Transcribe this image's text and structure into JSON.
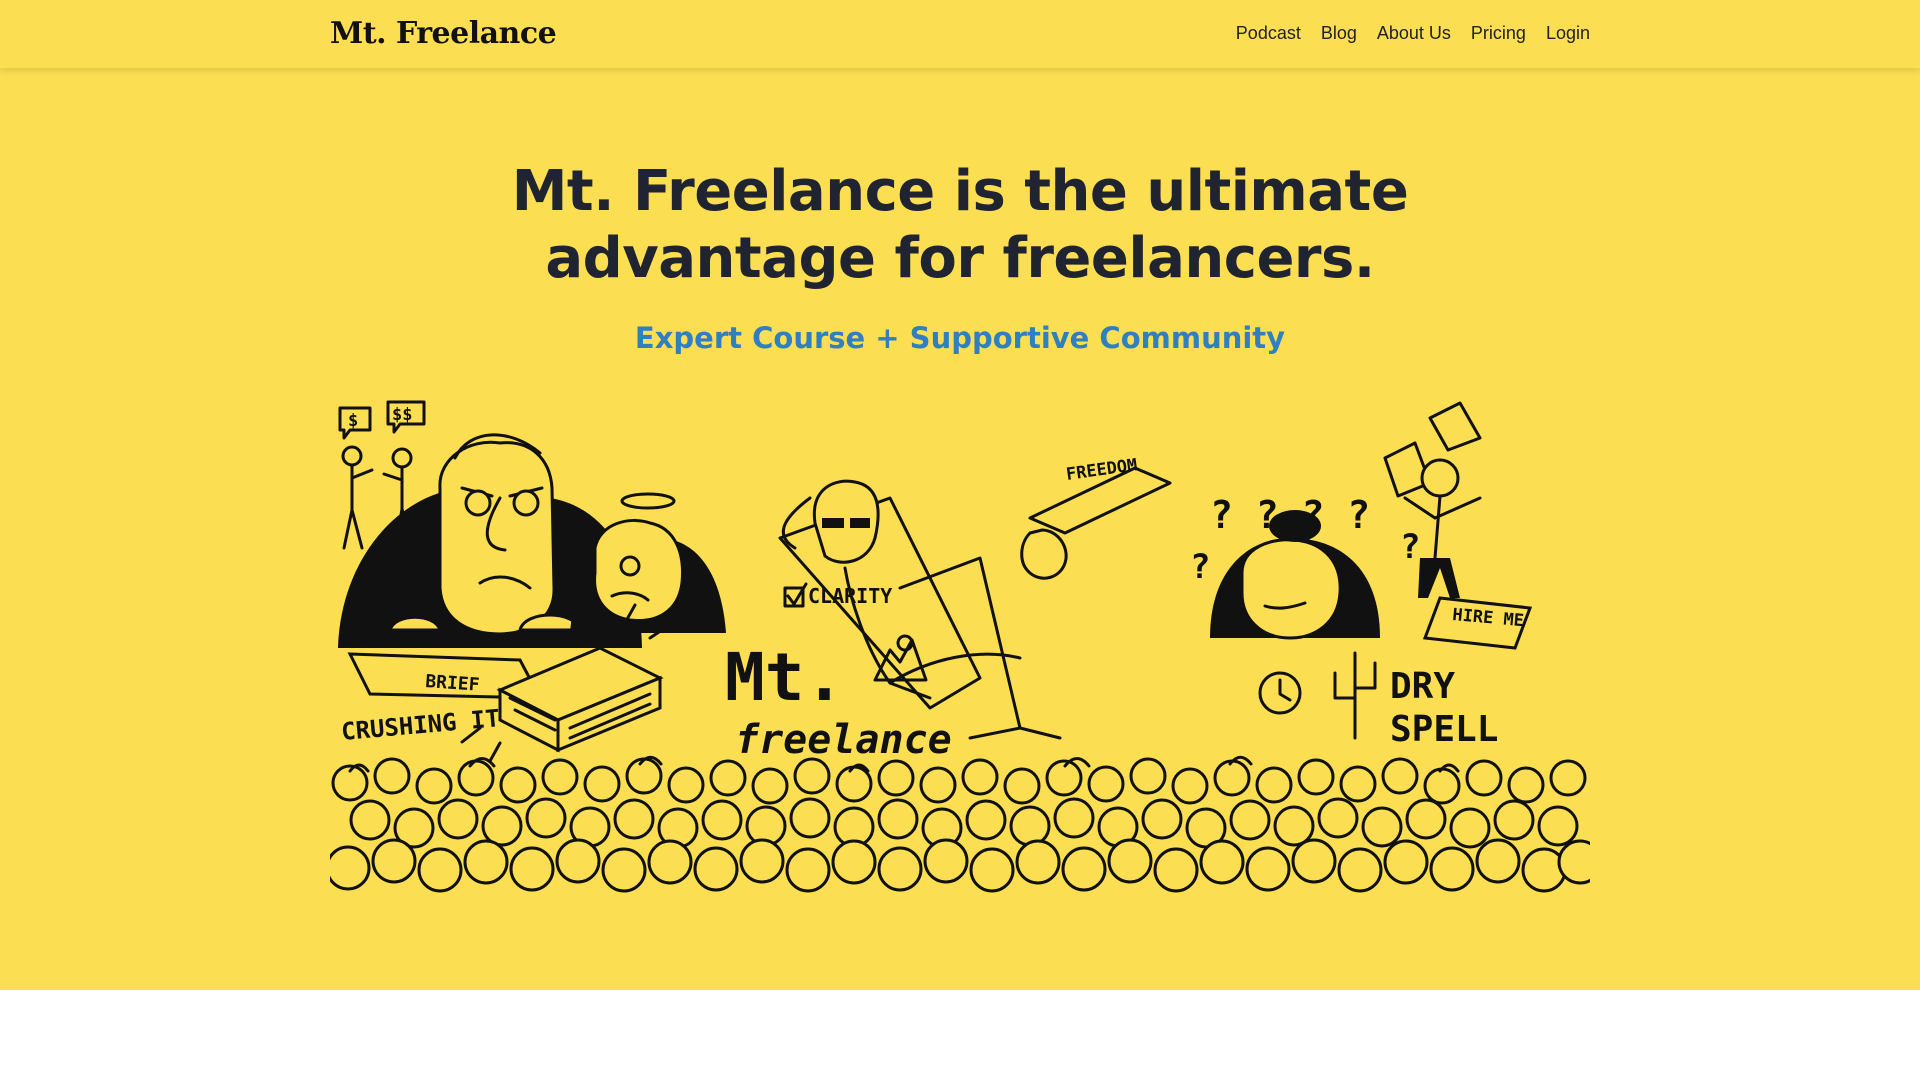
{
  "header": {
    "logo": "Mt. Freelance",
    "nav": [
      "Podcast",
      "Blog",
      "About Us",
      "Pricing",
      "Login"
    ]
  },
  "hero": {
    "headline": "Mt. Freelance is the ultimate advantage for freelancers.",
    "subhead": "Expert Course + Supportive Community",
    "illustration_labels": {
      "money_small": "$",
      "money_big": "$$",
      "brief": "BRIEF",
      "crushing": "CRUSHING IT",
      "clarity": "CLARITY",
      "logo_top": "Mt.",
      "logo_bottom": "freelance",
      "freedom": "FREEDOM",
      "hire": "HIRE ME",
      "dry": "DRY",
      "spell": "SPELL"
    }
  },
  "colors": {
    "background": "#fbde52",
    "headline": "#1f2430",
    "accent_blue": "#2f7fc1",
    "ink": "#111111"
  }
}
